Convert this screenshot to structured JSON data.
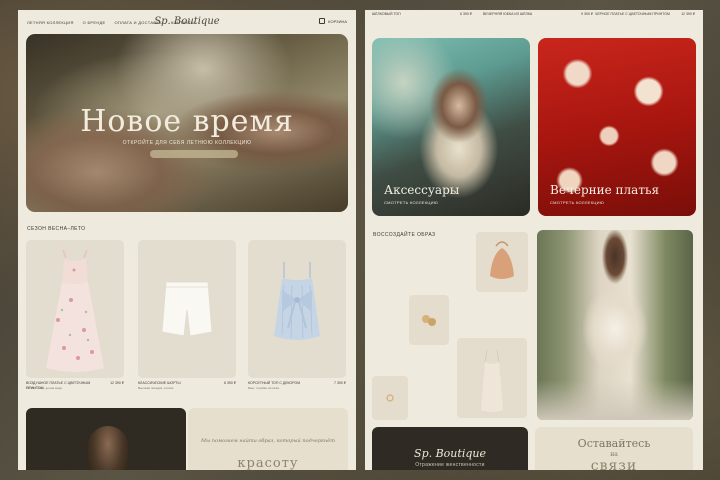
{
  "left": {
    "nav": [
      "Летняя коллекция",
      "О бренде",
      "Оплата и доставка",
      "Контакты"
    ],
    "logo": "Sp. Boutique",
    "cart_label": "Корзина",
    "hero": {
      "title": "Новое время",
      "subtitle": "Откройте для себя летнюю коллекцию"
    },
    "section_title": "Сезон весна–лето",
    "products": [
      {
        "name": "Воздушное платье с цветочным принтом",
        "desc": "Лёгкая ткань, длина миди",
        "price": "12 390 ₽"
      },
      {
        "name": "Классические шорты",
        "desc": "Высокая посадка, хлопок",
        "price": "6 390 ₽"
      },
      {
        "name": "Корсетный топ с декором",
        "desc": "Бант, голубая полоска",
        "price": "7 390 ₽"
      }
    ],
    "quote": "Мы помогаем найти образ, который подчеркнёт",
    "beauty_word": "красоту"
  },
  "right": {
    "top_row": [
      {
        "name": "Шёлковый топ",
        "price": "6 390 ₽"
      },
      {
        "name": "Вечерняя юбка из шёлка",
        "price": "9 390 ₽"
      },
      {
        "name": "Черное платье с цветочным принтом",
        "price": "12 390 ₽"
      }
    ],
    "tiles": [
      {
        "label": "Аксессуары",
        "link": "Смотреть коллекцию"
      },
      {
        "label": "Вечерние платья",
        "link": "Смотреть коллекцию"
      }
    ],
    "section_title": "Воссоздайте образ",
    "brand": {
      "name": "Sp. Boutique",
      "slogan": "Отражение женственности"
    },
    "stay": {
      "line1": "Оставайтесь",
      "line2": "на",
      "line3": "связи"
    }
  },
  "colors": {
    "bg": "#4a463b",
    "panel": "#efeade",
    "dark": "#2f2b24",
    "accent": "#8d846d"
  }
}
